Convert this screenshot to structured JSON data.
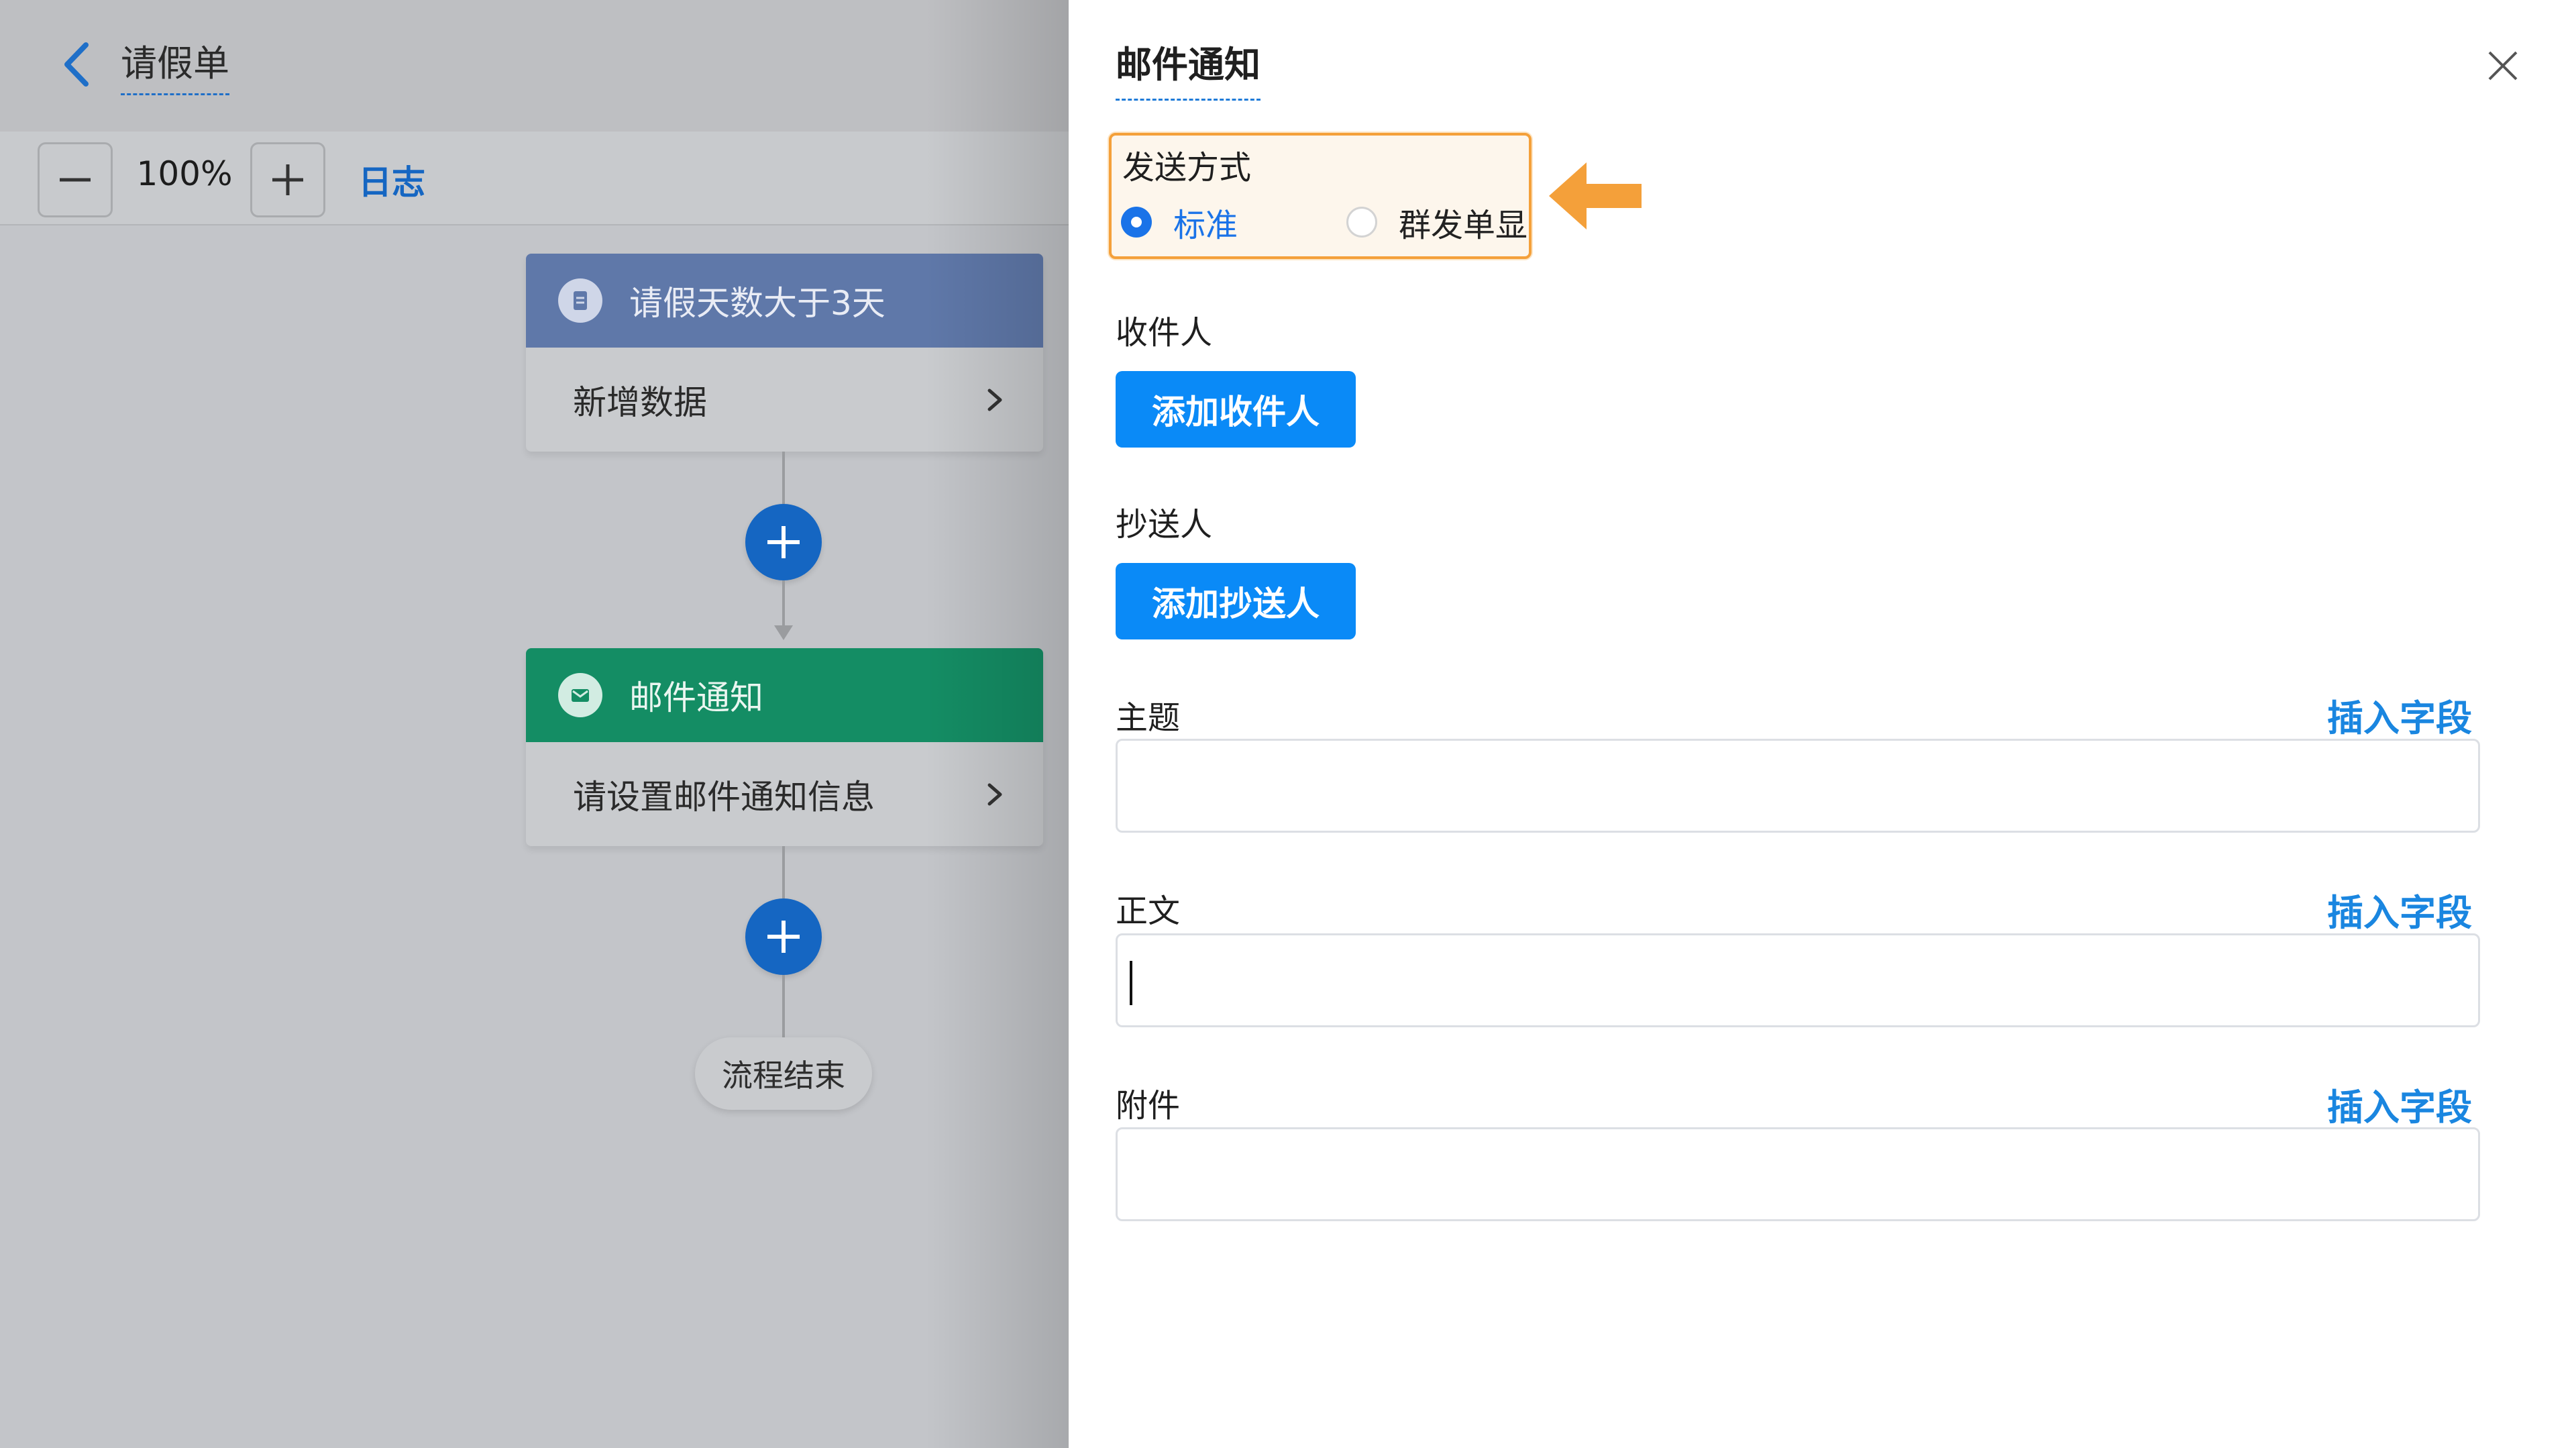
{
  "left": {
    "form_title": "请假单",
    "toolbar": {
      "zoom_level": "100%",
      "log_label": "日志"
    },
    "nodes": [
      {
        "title": "请假天数大于3天",
        "body": "新增数据"
      },
      {
        "title": "邮件通知",
        "body": "请设置邮件通知信息"
      }
    ],
    "end_label": "流程结束"
  },
  "drawer": {
    "title": "邮件通知",
    "send_mode": {
      "label": "发送方式",
      "options": [
        {
          "label": "标准",
          "selected": true
        },
        {
          "label": "群发单显",
          "selected": false
        }
      ]
    },
    "recipients": {
      "label": "收件人",
      "button": "添加收件人"
    },
    "cc": {
      "label": "抄送人",
      "button": "添加抄送人"
    },
    "subject": {
      "label": "主题",
      "insert": "插入字段",
      "value": ""
    },
    "body": {
      "label": "正文",
      "insert": "插入字段",
      "value": ""
    },
    "attachment": {
      "label": "附件",
      "insert": "插入字段",
      "value": ""
    }
  },
  "colors": {
    "accent_blue": "#0a8af7",
    "highlight_orange": "#f4a03a",
    "condition_node": "#5f78a9",
    "email_node": "#148d64"
  }
}
